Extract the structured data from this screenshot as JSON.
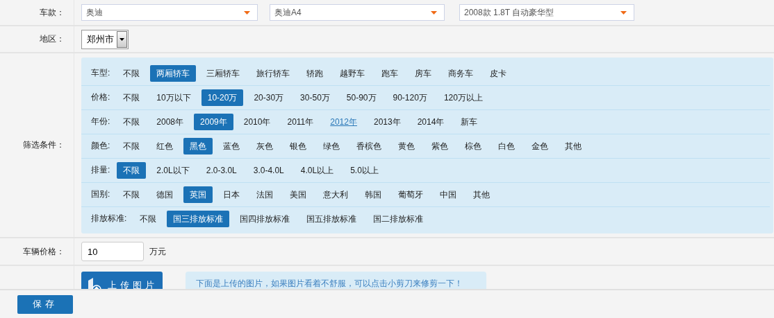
{
  "model_row": {
    "label": "车款：",
    "selects": [
      {
        "value": "奥迪"
      },
      {
        "value": "奥迪A4"
      },
      {
        "value": "2008款 1.8T 自动豪华型"
      }
    ]
  },
  "region_row": {
    "label": "地区：",
    "value": "郑州市"
  },
  "filter_row": {
    "label": "筛选条件：",
    "groups": [
      {
        "label": "车型:",
        "options": [
          {
            "label": "不限",
            "selected": false
          },
          {
            "label": "两厢轿车",
            "selected": true
          },
          {
            "label": "三厢轿车",
            "selected": false
          },
          {
            "label": "旅行轿车",
            "selected": false
          },
          {
            "label": "轿跑",
            "selected": false
          },
          {
            "label": "越野车",
            "selected": false
          },
          {
            "label": "跑车",
            "selected": false
          },
          {
            "label": "房车",
            "selected": false
          },
          {
            "label": "商务车",
            "selected": false
          },
          {
            "label": "皮卡",
            "selected": false
          }
        ]
      },
      {
        "label": "价格:",
        "options": [
          {
            "label": "不限",
            "selected": false
          },
          {
            "label": "10万以下",
            "selected": false
          },
          {
            "label": "10-20万",
            "selected": true
          },
          {
            "label": "20-30万",
            "selected": false
          },
          {
            "label": "30-50万",
            "selected": false
          },
          {
            "label": "50-90万",
            "selected": false
          },
          {
            "label": "90-120万",
            "selected": false
          },
          {
            "label": "120万以上",
            "selected": false
          }
        ]
      },
      {
        "label": "年份:",
        "options": [
          {
            "label": "不限",
            "selected": false,
            "hovered": false
          },
          {
            "label": "2008年",
            "selected": false,
            "hovered": false
          },
          {
            "label": "2009年",
            "selected": true,
            "hovered": false
          },
          {
            "label": "2010年",
            "selected": false,
            "hovered": false
          },
          {
            "label": "2011年",
            "selected": false,
            "hovered": false
          },
          {
            "label": "2012年",
            "selected": false,
            "hovered": true
          },
          {
            "label": "2013年",
            "selected": false,
            "hovered": false
          },
          {
            "label": "2014年",
            "selected": false,
            "hovered": false
          },
          {
            "label": "新车",
            "selected": false,
            "hovered": false
          }
        ]
      },
      {
        "label": "颜色:",
        "options": [
          {
            "label": "不限",
            "selected": false
          },
          {
            "label": "红色",
            "selected": false
          },
          {
            "label": "黑色",
            "selected": true
          },
          {
            "label": "蓝色",
            "selected": false
          },
          {
            "label": "灰色",
            "selected": false
          },
          {
            "label": "银色",
            "selected": false
          },
          {
            "label": "绿色",
            "selected": false
          },
          {
            "label": "香槟色",
            "selected": false
          },
          {
            "label": "黄色",
            "selected": false
          },
          {
            "label": "紫色",
            "selected": false
          },
          {
            "label": "棕色",
            "selected": false
          },
          {
            "label": "白色",
            "selected": false
          },
          {
            "label": "金色",
            "selected": false
          },
          {
            "label": "其他",
            "selected": false
          }
        ]
      },
      {
        "label": "排量:",
        "options": [
          {
            "label": "不限",
            "selected": true
          },
          {
            "label": "2.0L以下",
            "selected": false
          },
          {
            "label": "2.0-3.0L",
            "selected": false
          },
          {
            "label": "3.0-4.0L",
            "selected": false
          },
          {
            "label": "4.0L以上",
            "selected": false
          },
          {
            "label": "5.0以上",
            "selected": false
          }
        ]
      },
      {
        "label": "国别:",
        "options": [
          {
            "label": "不限",
            "selected": false
          },
          {
            "label": "德国",
            "selected": false
          },
          {
            "label": "英国",
            "selected": true
          },
          {
            "label": "日本",
            "selected": false
          },
          {
            "label": "法国",
            "selected": false
          },
          {
            "label": "美国",
            "selected": false
          },
          {
            "label": "意大利",
            "selected": false
          },
          {
            "label": "韩国",
            "selected": false
          },
          {
            "label": "葡萄牙",
            "selected": false
          },
          {
            "label": "中国",
            "selected": false
          },
          {
            "label": "其他",
            "selected": false
          }
        ]
      },
      {
        "label": "排放标准:",
        "options": [
          {
            "label": "不限",
            "selected": false
          },
          {
            "label": "国三排放标准",
            "selected": true
          },
          {
            "label": "国四排放标准",
            "selected": false
          },
          {
            "label": "国五排放标准",
            "selected": false
          },
          {
            "label": "国二排放标准",
            "selected": false
          }
        ]
      }
    ]
  },
  "price_row": {
    "label": "车辆价格：",
    "value": "10",
    "unit": "万元"
  },
  "upload_row": {
    "button": "上传图片",
    "hint": "下面是上传的图片，如果图片看着不舒服，可以点击小剪刀来修剪一下！"
  },
  "footer": {
    "save_button": "保存"
  }
}
